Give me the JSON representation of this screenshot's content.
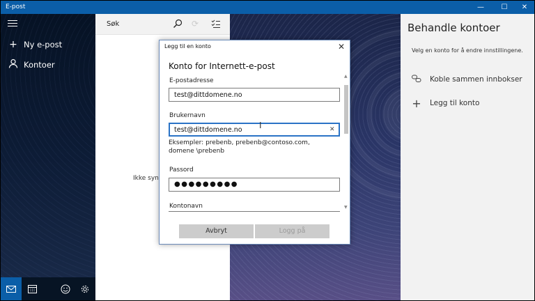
{
  "window": {
    "title": "E-post",
    "controls": {
      "minimize": "—",
      "maximize": "☐",
      "close": "✕"
    }
  },
  "nav": {
    "new_mail": {
      "icon": "plus-icon",
      "label": "Ny e-post"
    },
    "accounts": {
      "icon": "person-icon",
      "label": "Kontoer"
    }
  },
  "list": {
    "search_placeholder": "Søk",
    "empty_text": "Ikke synkr"
  },
  "panel": {
    "title": "Behandle kontoer",
    "description": "Velg en konto for å endre innstillingene.",
    "items": [
      {
        "icon": "link-icon",
        "label": "Koble sammen innbokser"
      },
      {
        "icon": "plus-icon",
        "label": "Legg til konto"
      }
    ]
  },
  "dialog": {
    "title": "Legg til en konto",
    "heading": "Konto for Internett-e-post",
    "email_label": "E-postadresse",
    "email_value": "test@dittdomene.no",
    "username_label": "Brukernavn",
    "username_value": "test@dittdomene.no",
    "hint": "Eksempler: prebenb, prebenb@contoso.com, domene \\prebenb",
    "password_label": "Passord",
    "password_value": "●●●●●●●●●",
    "account_name_label": "Kontonavn",
    "cancel_label": "Avbryt",
    "login_label": "Logg på"
  },
  "colors": {
    "accent": "#0b5ea8",
    "focus": "#2a73c6"
  }
}
